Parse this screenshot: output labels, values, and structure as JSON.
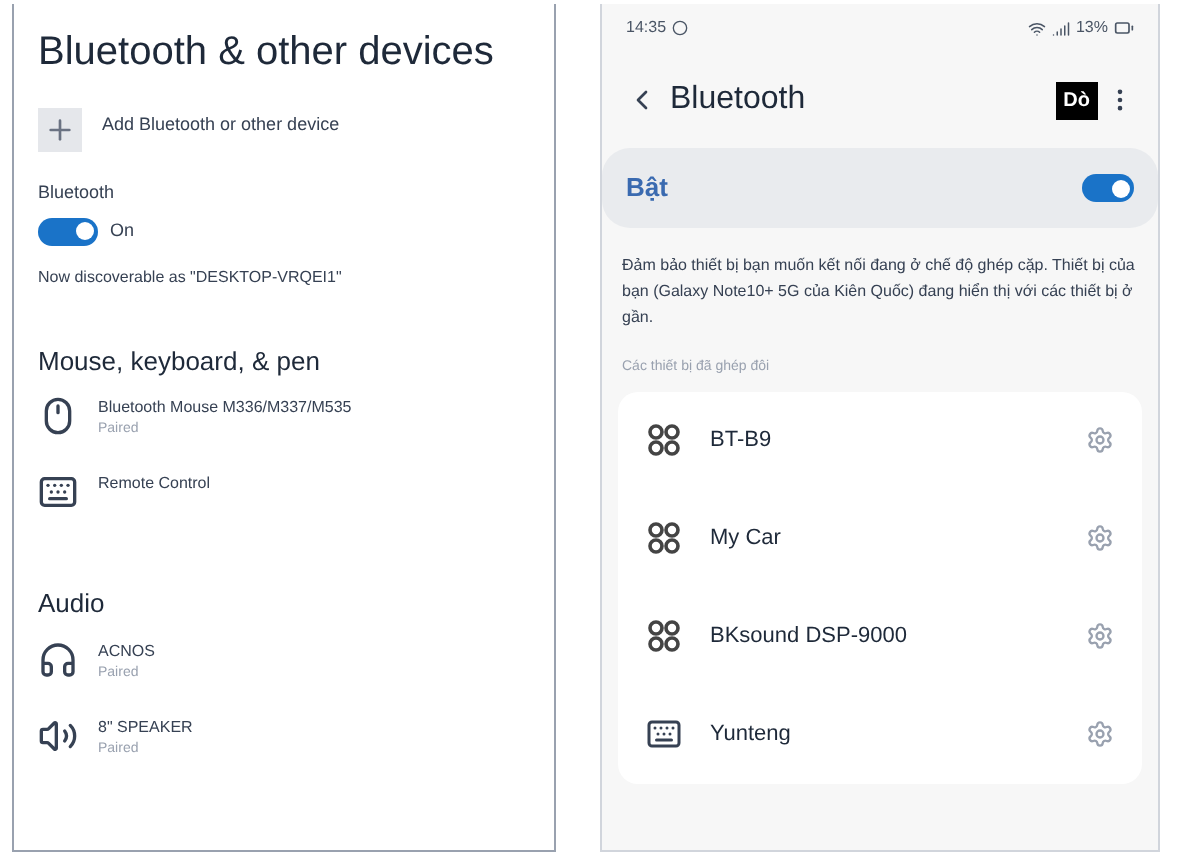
{
  "windows_settings": {
    "title": "Bluetooth & other devices",
    "add_device": "Add Bluetooth or other device",
    "bluetooth_label": "Bluetooth",
    "bluetooth_toggle": {
      "on": true,
      "text": "On"
    },
    "discoverable": "Now discoverable as \"DESKTOP-VRQEI1\"",
    "sections": [
      {
        "title": "Mouse, keyboard, & pen",
        "devices": [
          {
            "kind": "mouse",
            "name": "Bluetooth Mouse M336/M337/M535",
            "status": "Paired"
          },
          {
            "kind": "keyboard",
            "name": "Remote Control"
          }
        ]
      },
      {
        "title": "Audio",
        "devices": [
          {
            "kind": "headset",
            "name": "ACNOS",
            "status": "Paired"
          },
          {
            "kind": "speaker",
            "name": "8\" SPEAKER",
            "status": "Paired"
          }
        ]
      }
    ]
  },
  "phone": {
    "status_bar": {
      "time": "14:35",
      "battery": "13%"
    },
    "title": "Bluetooth",
    "scan_button": "Dò",
    "toggle_row": {
      "label": "Bật",
      "on": true
    },
    "description": "Đảm bảo thiết bị bạn muốn kết nối đang ở chế độ ghép cặp. Thiết bị của bạn (Galaxy Note10+ 5G của Kiên Quốc) đang hiển thị với các thiết bị ở gần.",
    "paired_header": "Các thiết bị đã ghép đôi",
    "devices": [
      {
        "kind": "earbuds",
        "name": "BT-B9"
      },
      {
        "kind": "earbuds",
        "name": "My Car"
      },
      {
        "kind": "earbuds",
        "name": "BKsound DSP-9000"
      },
      {
        "kind": "keyboard",
        "name": "Yunteng"
      }
    ]
  }
}
